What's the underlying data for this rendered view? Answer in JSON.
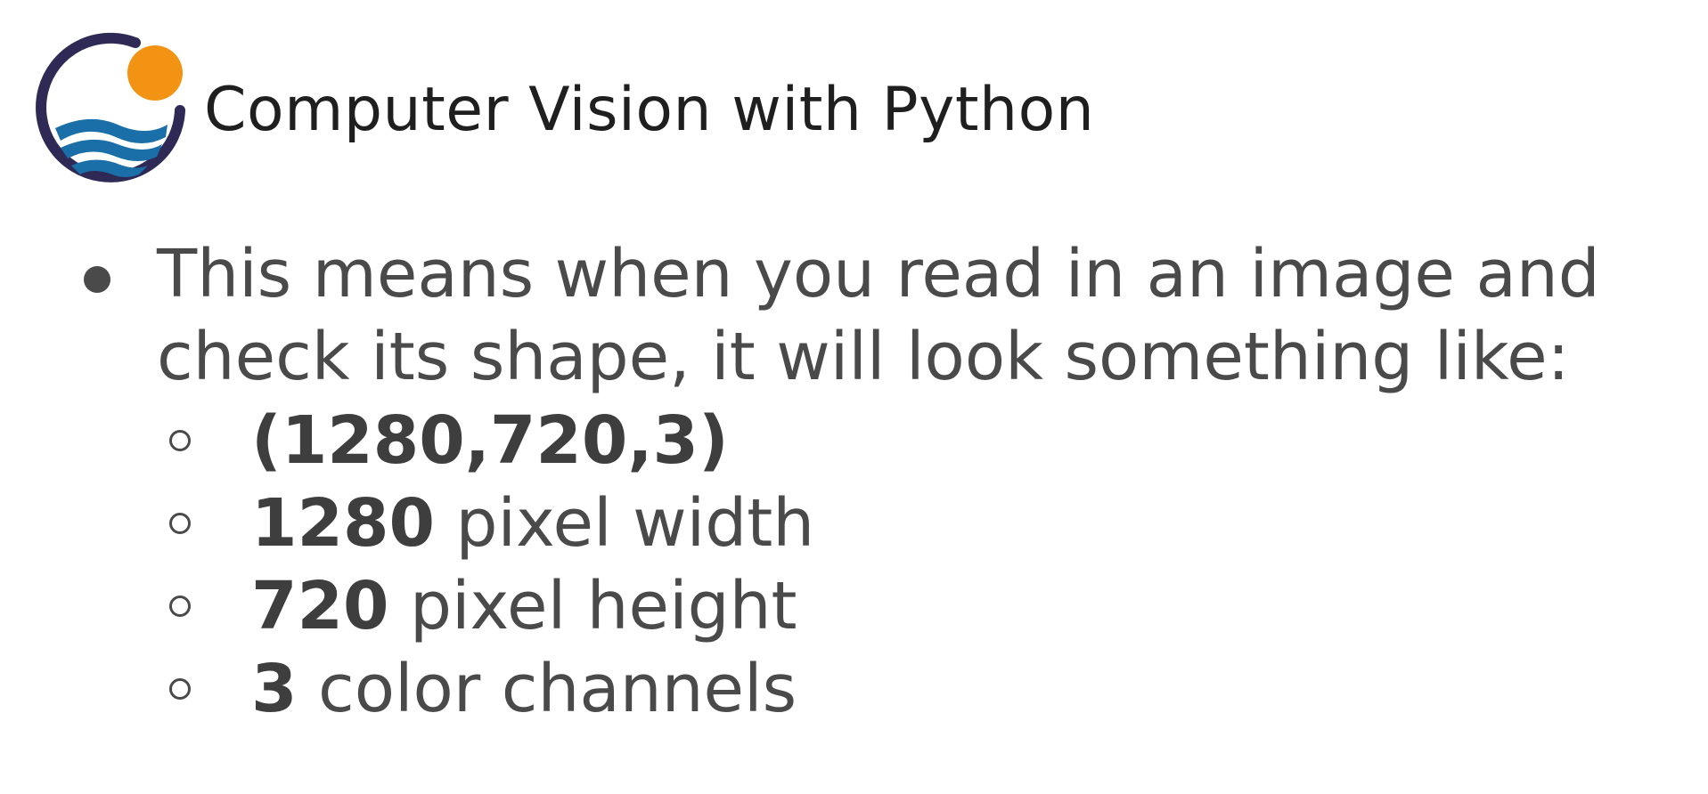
{
  "header": {
    "title": "Computer Vision with Python",
    "logo_icon": "sun-over-waves-logo",
    "colors": {
      "ring": "#2e2a55",
      "sun": "#f39313",
      "wave": "#1a6fa8"
    }
  },
  "bullet": {
    "text_line1": "This means when you read in an image and",
    "text_line2": "check its shape, it will look something like:"
  },
  "sub_items": [
    {
      "bold": "(1280,720,3)",
      "rest": ""
    },
    {
      "bold": "1280",
      "rest": " pixel width"
    },
    {
      "bold": "720",
      "rest": " pixel height"
    },
    {
      "bold": "3",
      "rest": " color channels"
    }
  ]
}
